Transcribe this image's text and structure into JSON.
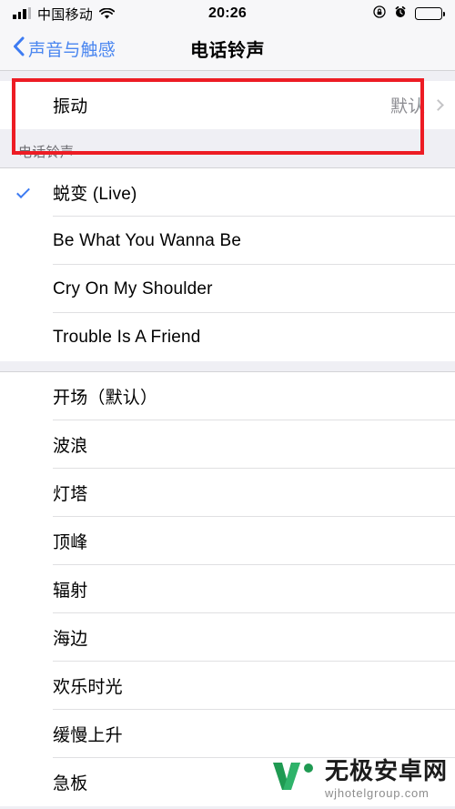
{
  "status_bar": {
    "carrier": "中国移动",
    "time": "20:26",
    "signal_icon": "signal-bars-icon",
    "wifi_icon": "wifi-icon",
    "rotation_lock_icon": "rotation-lock-icon",
    "alarm_icon": "alarm-clock-icon",
    "battery_icon": "battery-full-icon"
  },
  "navbar": {
    "back_label": "声音与触感",
    "back_icon": "chevron-left-icon",
    "title": "电话铃声"
  },
  "vibration_group": {
    "row_label": "振动",
    "row_value": "默认",
    "chevron_icon": "chevron-right-icon",
    "highlight_color": "#ed1c24"
  },
  "ringtone_section": {
    "header": "电话铃声",
    "check_color": "#3d7bf2",
    "custom_group": [
      {
        "label": "蜕变 (Live)",
        "selected": true
      },
      {
        "label": "Be What You Wanna Be",
        "selected": false
      },
      {
        "label": "Cry On My Shoulder",
        "selected": false
      },
      {
        "label": "Trouble Is A Friend",
        "selected": false
      }
    ],
    "stock_group": [
      {
        "label": "开场（默认）",
        "selected": false
      },
      {
        "label": "波浪",
        "selected": false
      },
      {
        "label": "灯塔",
        "selected": false
      },
      {
        "label": "顶峰",
        "selected": false
      },
      {
        "label": "辐射",
        "selected": false
      },
      {
        "label": "海边",
        "selected": false
      },
      {
        "label": "欢乐时光",
        "selected": false
      },
      {
        "label": "缓慢上升",
        "selected": false
      },
      {
        "label": "急板",
        "selected": false
      }
    ]
  },
  "watermark": {
    "logo_icon": "wj-logo-icon",
    "name": "无极安卓网",
    "url": "wjhotelgroup.com",
    "brand_color": "#2e9e5b"
  }
}
